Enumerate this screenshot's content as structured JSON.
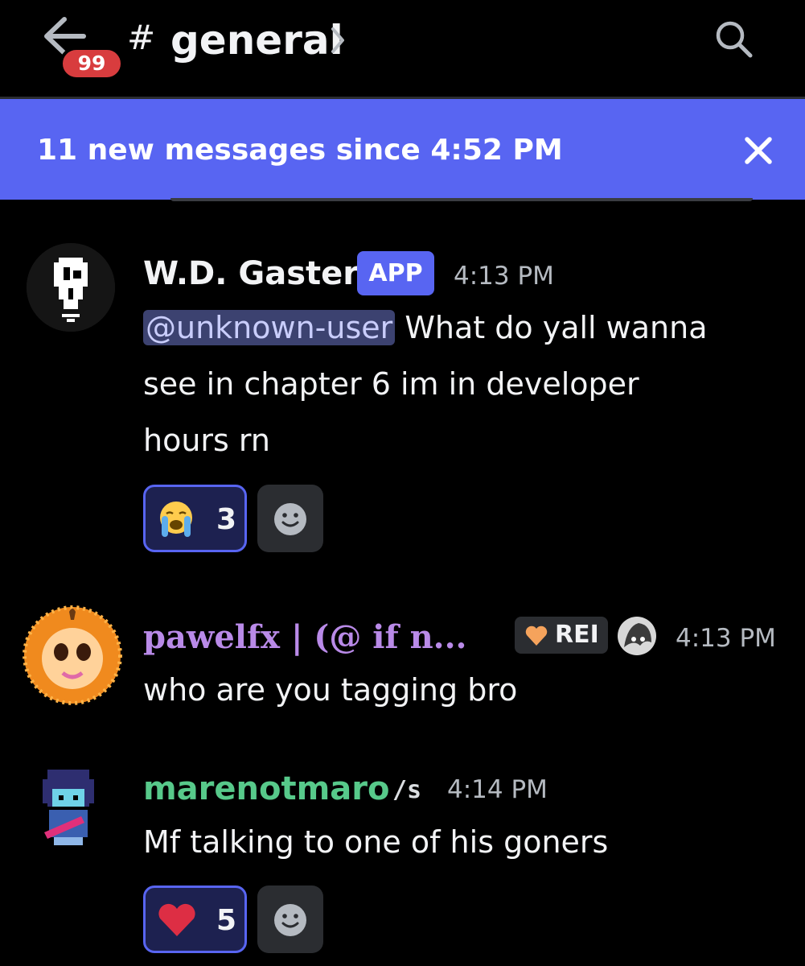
{
  "header": {
    "unread_badge": "99",
    "channel_hash": "#",
    "channel_name": "general",
    "icons": [
      "back-arrow-icon",
      "chevron-right-icon",
      "search-icon"
    ]
  },
  "banner": {
    "text": "11 new messages since 4:52 PM",
    "close_icon": "close-icon"
  },
  "messages": [
    {
      "author": "W.D. Gaster",
      "author_color": "#f2f3f5",
      "tag": "APP",
      "timestamp": "4:13 PM",
      "mention": "@unknown-user",
      "lines": [
        " What do yall wanna",
        "see in chapter 6 im in developer",
        "hours rn"
      ],
      "reactions": [
        {
          "emoji": "loudly-crying-face",
          "count": "3",
          "active": true
        }
      ]
    },
    {
      "author": "pawelfx | (@ if n...",
      "author_color": "#b98ae8",
      "tag": "REI",
      "timestamp": "4:13 PM",
      "lines": [
        "who are you tagging bro"
      ]
    },
    {
      "author": "marenotmaro",
      "author_color": "#57c98a",
      "tag": "/s",
      "timestamp": "4:14 PM",
      "lines": [
        "Mf talking to one of his goners"
      ],
      "reactions": [
        {
          "emoji": "red-heart",
          "count": "5",
          "active": true
        }
      ]
    }
  ],
  "colors": {
    "accent": "#5865f2",
    "badge": "#d83c3e",
    "mention_bg": "#3c4270"
  }
}
